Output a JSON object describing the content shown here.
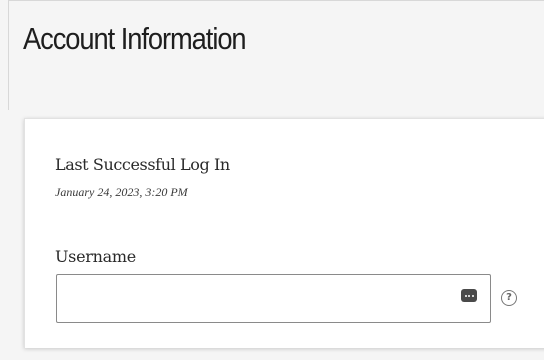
{
  "header": {
    "title": "Account Information"
  },
  "account": {
    "last_login_label": "Last Successful Log In",
    "last_login_value": "January 24, 2023, 3:20 PM",
    "username_label": "Username",
    "username_value": "",
    "username_placeholder": ""
  },
  "icons": {
    "autofill": "autofill-dots-icon",
    "help": "?"
  }
}
